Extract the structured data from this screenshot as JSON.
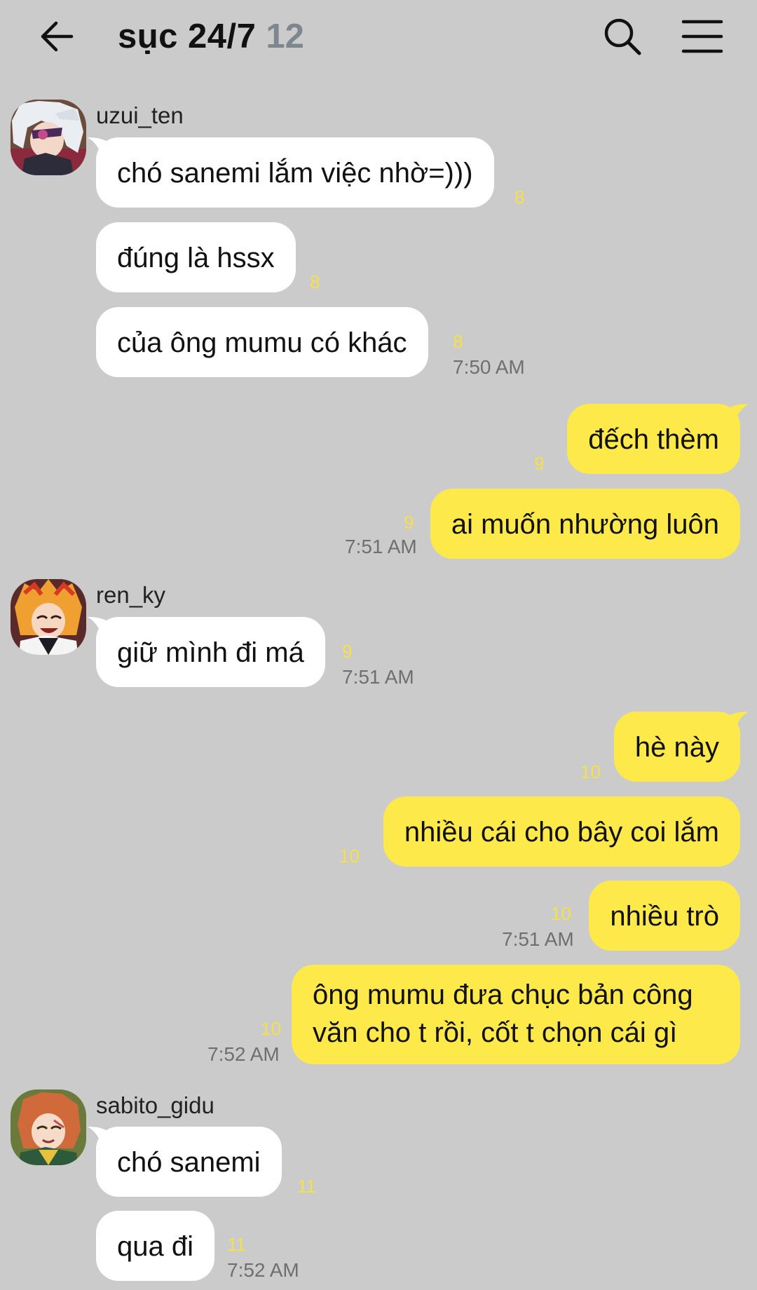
{
  "header": {
    "title": "sục 24/7",
    "member_count": "12",
    "back_icon": "arrow-left-icon",
    "search_icon": "search-icon",
    "menu_icon": "hamburger-menu-icon"
  },
  "colors": {
    "background": "#cbcbcb",
    "incoming_bubble": "#ffffff",
    "outgoing_bubble": "#fde94a",
    "unread_count": "#f5e04a",
    "timestamp": "#6f6f6f",
    "member_count": "#7e8790"
  },
  "messages": [
    {
      "sender": "uzui_ten",
      "direction": "in",
      "text": "chó sanemi lắm việc nhờ=)))",
      "unread": "8"
    },
    {
      "direction": "in",
      "text": "đúng là hssx",
      "unread": "8"
    },
    {
      "direction": "in",
      "text": "của ông mumu có khác",
      "unread": "8",
      "time": "7:50 AM"
    },
    {
      "direction": "out",
      "text": "đếch thèm",
      "unread": "9"
    },
    {
      "direction": "out",
      "text": "ai muốn nhường luôn",
      "unread": "9",
      "time": "7:51 AM"
    },
    {
      "sender": "ren_ky",
      "direction": "in",
      "text": "giữ mình đi má",
      "unread": "9",
      "time": "7:51 AM"
    },
    {
      "direction": "out",
      "text": "hè này",
      "unread": "10"
    },
    {
      "direction": "out",
      "text": "nhiều cái cho bây coi lắm",
      "unread": "10"
    },
    {
      "direction": "out",
      "text": "nhiều trò",
      "unread": "10",
      "time": "7:51 AM"
    },
    {
      "direction": "out",
      "text": "ông mumu đưa chục bản công văn cho t rồi, cốt t chọn cái gì",
      "unread": "10",
      "time": "7:52 AM"
    },
    {
      "sender": "sabito_gidu",
      "direction": "in",
      "text": "chó sanemi",
      "unread": "11"
    },
    {
      "direction": "in",
      "text": "qua đi",
      "unread": "11",
      "time": "7:52 AM"
    }
  ]
}
